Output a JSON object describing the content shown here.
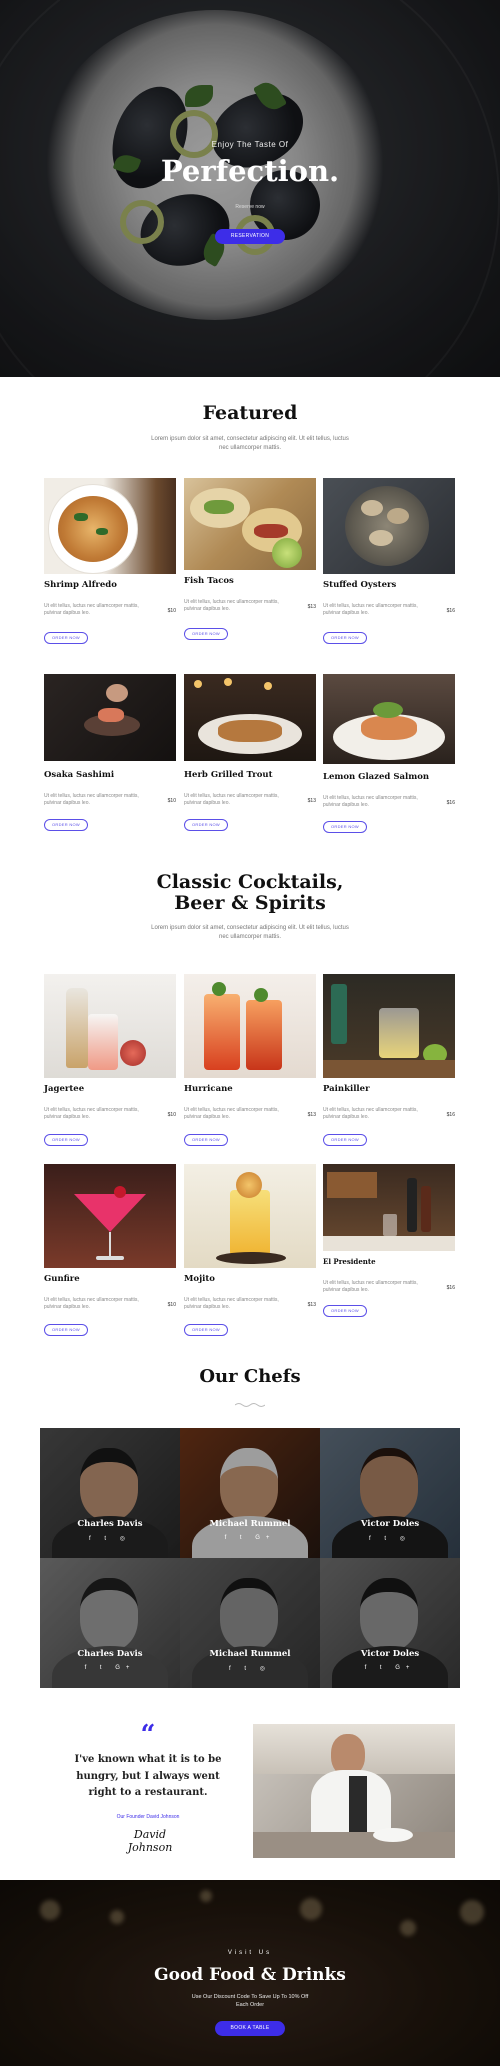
{
  "hero": {
    "kicker": "Enjoy The Taste Of",
    "title": "Perfection.",
    "subtitle": "Reserve now",
    "button": "RESERVATION"
  },
  "featured": {
    "title": "Featured",
    "description": "Lorem ipsum dolor sit amet, consectetur adipiscing elit. Ut elit tellus, luctus nec ullamcorper mattis.",
    "items": [
      {
        "name": "Shrimp Alfredo",
        "desc": "Ut elit tellus, luctus nec ullamcorper mattis, pulvinar dapibus leo.",
        "price": "$10",
        "button": "ORDER NOW"
      },
      {
        "name": "Fish Tacos",
        "desc": "Ut elit tellus, luctus nec ullamcorper mattis, pulvinar dapibus leo.",
        "price": "$13",
        "button": "ORDER NOW"
      },
      {
        "name": "Stuffed Oysters",
        "desc": "Ut elit tellus, luctus nec ullamcorper mattis, pulvinar dapibus leo.",
        "price": "$16",
        "button": "ORDER NOW"
      },
      {
        "name": "Osaka Sashimi",
        "desc": "Ut elit tellus, luctus nec ullamcorper mattis, pulvinar dapibus leo.",
        "price": "$10",
        "button": "ORDER NOW"
      },
      {
        "name": "Herb Grilled Trout",
        "desc": "Ut elit tellus, luctus nec ullamcorper mattis, pulvinar dapibus leo.",
        "price": "$13",
        "button": "ORDER NOW"
      },
      {
        "name": "Lemon Glazed Salmon",
        "desc": "Ut elit tellus, luctus nec ullamcorper mattis, pulvinar dapibus leo.",
        "price": "$16",
        "button": "ORDER NOW"
      }
    ]
  },
  "cocktails": {
    "title_line1": "Classic Cocktails,",
    "title_line2": "Beer & Spirits",
    "description": "Lorem ipsum dolor sit amet, consectetur adipiscing elit. Ut elit tellus, luctus nec ullamcorper mattis.",
    "items": [
      {
        "name": "Jagertee",
        "desc": "Ut elit tellus, luctus nec ullamcorper mattis, pulvinar dapibus leo.",
        "price": "$10",
        "button": "ORDER NOW"
      },
      {
        "name": "Hurricane",
        "desc": "Ut elit tellus, luctus nec ullamcorper mattis, pulvinar dapibus leo.",
        "price": "$13",
        "button": "ORDER NOW"
      },
      {
        "name": "Painkiller",
        "desc": "Ut elit tellus, luctus nec ullamcorper mattis, pulvinar dapibus leo.",
        "price": "$16",
        "button": "ORDER NOW"
      },
      {
        "name": "Gunfire",
        "desc": "Ut elit tellus, luctus nec ullamcorper mattis, pulvinar dapibus leo.",
        "price": "$10",
        "button": "ORDER NOW"
      },
      {
        "name": "Mojito",
        "desc": "Ut elit tellus, luctus nec ullamcorper mattis, pulvinar dapibus leo.",
        "price": "$13",
        "button": "ORDER NOW"
      },
      {
        "name": "El Presidente",
        "desc": "Ut elit tellus, luctus nec ullamcorper mattis, pulvinar dapibus leo.",
        "price": "$16",
        "button": "ORDER NOW"
      }
    ]
  },
  "chefs": {
    "title": "Our Chefs",
    "items": [
      {
        "name": "Charles Davis",
        "social": "f t ◎"
      },
      {
        "name": "Michael Rummel",
        "social": "f t G+"
      },
      {
        "name": "Victor Doles",
        "social": "f t ◎"
      },
      {
        "name": "Charles Davis",
        "social": "f t G+"
      },
      {
        "name": "Michael Rummel",
        "social": "f t ◎"
      },
      {
        "name": "Victor Doles",
        "social": "f t G+"
      }
    ]
  },
  "testimonial": {
    "quote_mark": "“",
    "quote": "I've known what it is to be hungry, but I always went right to a restaurant.",
    "author": "Our Founder David Johnson",
    "signature": "David Johnson"
  },
  "cta": {
    "kicker": "Visit Us",
    "title": "Good Food & Drinks",
    "description": "Use Our Discount Code To Save Up To 10% Off Each Order",
    "button": "BOOK A TABLE"
  },
  "colors": {
    "accent": "#3d2de8"
  }
}
